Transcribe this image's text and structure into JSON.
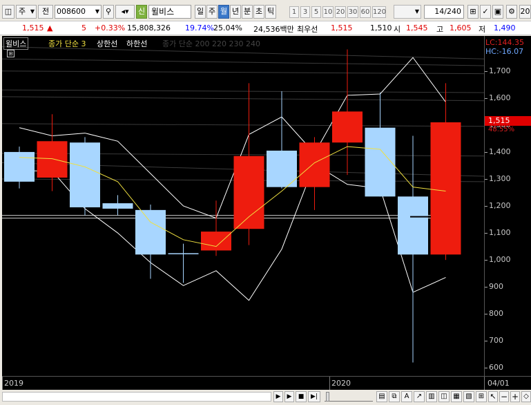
{
  "toolbar": {
    "period_labels": [
      "일",
      "주",
      "월",
      "년",
      "분",
      "초",
      "틱"
    ],
    "active_period": "월",
    "n_buttons": [
      "1",
      "3",
      "5",
      "10",
      "20",
      "30",
      "60",
      "120"
    ],
    "code": "008600",
    "market_tag": "신",
    "stock_name": "윌비스",
    "type1": "주",
    "type2": "전",
    "counter": "14",
    "counter_total": "/240",
    "corner_num": "20"
  },
  "quote": {
    "price": "1,515",
    "arrow": "▲",
    "change": "5",
    "change_pct": "+0.33%",
    "volume": "15,808,326",
    "turnover_pct": "19.74%",
    "ratio_pct": "25.04%",
    "amount": "24,536백만",
    "label_best": "최우선",
    "best_ask": "1,515",
    "best_bid": "1,510",
    "open_label": "시",
    "open": "1,545",
    "high_label": "고",
    "high": "1,605",
    "low_label": "저",
    "low": "1,490"
  },
  "legend": {
    "name": "윌비스",
    "ma": "종가 단순 3",
    "upper": "상한선",
    "lower": "하한선",
    "faint": "종가 단순 200  220  230  240"
  },
  "indicators": {
    "lc": "LC:144.35",
    "hc": "HC:-16.07",
    "current_price": "1,515",
    "current_pct": "48.55%"
  },
  "xaxis": {
    "labels": [
      "2019",
      "2020"
    ],
    "right_label": "04/01"
  },
  "chart_data": {
    "type": "candlestick",
    "ylim": [
      570,
      1830
    ],
    "yticks": [
      600,
      700,
      800,
      900,
      1000,
      1100,
      1200,
      1300,
      1400,
      1500,
      1600,
      1700
    ],
    "ytick_labels": [
      "600",
      "700",
      "800",
      "900",
      "1,000",
      "1,100",
      "1,200",
      "1,300",
      "1,400",
      "1,500",
      "1,600",
      "1,700"
    ],
    "candles": [
      {
        "open": 1290,
        "high": 1420,
        "low": 1265,
        "close": 1400,
        "dir": "down"
      },
      {
        "open": 1305,
        "high": 1540,
        "low": 1255,
        "close": 1440,
        "dir": "up"
      },
      {
        "open": 1435,
        "high": 1455,
        "low": 1165,
        "close": 1195,
        "dir": "down"
      },
      {
        "open": 1210,
        "high": 1240,
        "low": 1165,
        "close": 1190,
        "dir": "down"
      },
      {
        "open": 1185,
        "high": 1205,
        "low": 930,
        "close": 1020,
        "dir": "down"
      },
      {
        "open": 1025,
        "high": 1060,
        "low": 915,
        "close": 1025,
        "dir": "down"
      },
      {
        "open": 1035,
        "high": 1220,
        "low": 1015,
        "close": 1105,
        "dir": "up"
      },
      {
        "open": 1115,
        "high": 1655,
        "low": 1055,
        "close": 1385,
        "dir": "up"
      },
      {
        "open": 1405,
        "high": 1625,
        "low": 1265,
        "close": 1270,
        "dir": "down"
      },
      {
        "open": 1270,
        "high": 1455,
        "low": 1185,
        "close": 1435,
        "dir": "up"
      },
      {
        "open": 1435,
        "high": 1780,
        "low": 1315,
        "close": 1550,
        "dir": "up"
      },
      {
        "open": 1490,
        "high": 1620,
        "low": 1235,
        "close": 1235,
        "dir": "down"
      },
      {
        "open": 1235,
        "high": 1460,
        "low": 620,
        "close": 1020,
        "dir": "down"
      },
      {
        "open": 1020,
        "high": 1655,
        "low": 1000,
        "close": 1510,
        "dir": "up"
      }
    ],
    "ma3": [
      1380,
      1375,
      1345,
      1290,
      1140,
      1075,
      1050,
      1160,
      1255,
      1360,
      1420,
      1410,
      1270,
      1255
    ],
    "upper_band": [
      1490,
      1460,
      1470,
      1440,
      1320,
      1200,
      1155,
      1465,
      1530,
      1395,
      1610,
      1615,
      1750,
      1585
    ],
    "lower_band": [
      1330,
      1330,
      1190,
      1100,
      990,
      905,
      960,
      850,
      1040,
      1355,
      1280,
      1265,
      880,
      935
    ],
    "hlines": [
      1165,
      1155
    ],
    "current_level": 1515
  },
  "colors": {
    "up": "#ee1c0e",
    "down": "#a8d6ff",
    "ma": "#f0e040",
    "band": "#ffffff",
    "bg": "#000000",
    "price_red": "#e00000",
    "price_blue": "#0000ff"
  }
}
